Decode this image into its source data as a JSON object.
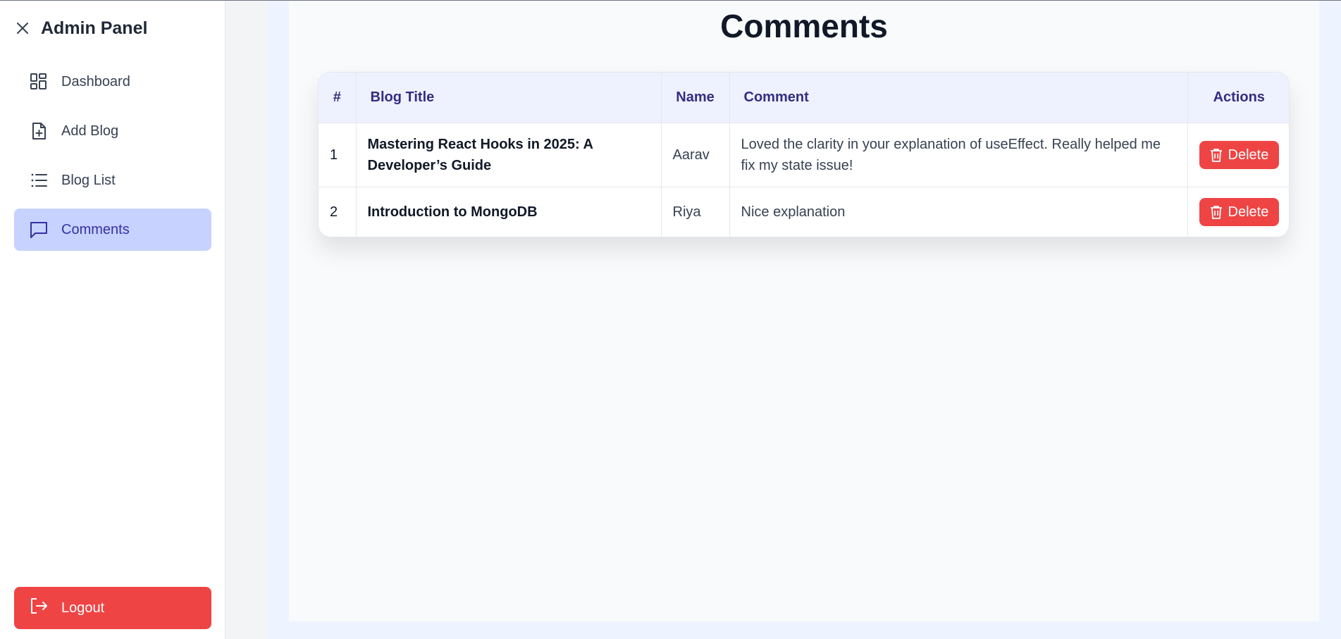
{
  "sidebar": {
    "title": "Admin Panel",
    "items": [
      {
        "label": "Dashboard",
        "icon": "dashboard-icon"
      },
      {
        "label": "Add Blog",
        "icon": "file-plus-icon"
      },
      {
        "label": "Blog List",
        "icon": "list-icon"
      },
      {
        "label": "Comments",
        "icon": "message-icon",
        "active": true
      }
    ],
    "logout_label": "Logout"
  },
  "main": {
    "title": "Comments",
    "table": {
      "headers": [
        "#",
        "Blog Title",
        "Name",
        "Comment",
        "Actions"
      ],
      "rows": [
        {
          "num": "1",
          "title": "Mastering React Hooks in 2025: A Developer’s Guide",
          "name": "Aarav",
          "comment": "Loved the clarity in your explanation of useEffect. Really helped me fix my state issue!",
          "action": "Delete"
        },
        {
          "num": "2",
          "title": "Introduction to MongoDB",
          "name": "Riya",
          "comment": "Nice explanation",
          "action": "Delete"
        }
      ]
    }
  },
  "colors": {
    "active_nav_bg": "#c7d2fe",
    "active_nav_text": "#3730a3",
    "danger": "#ef4444",
    "header_bg": "#eef2ff"
  }
}
